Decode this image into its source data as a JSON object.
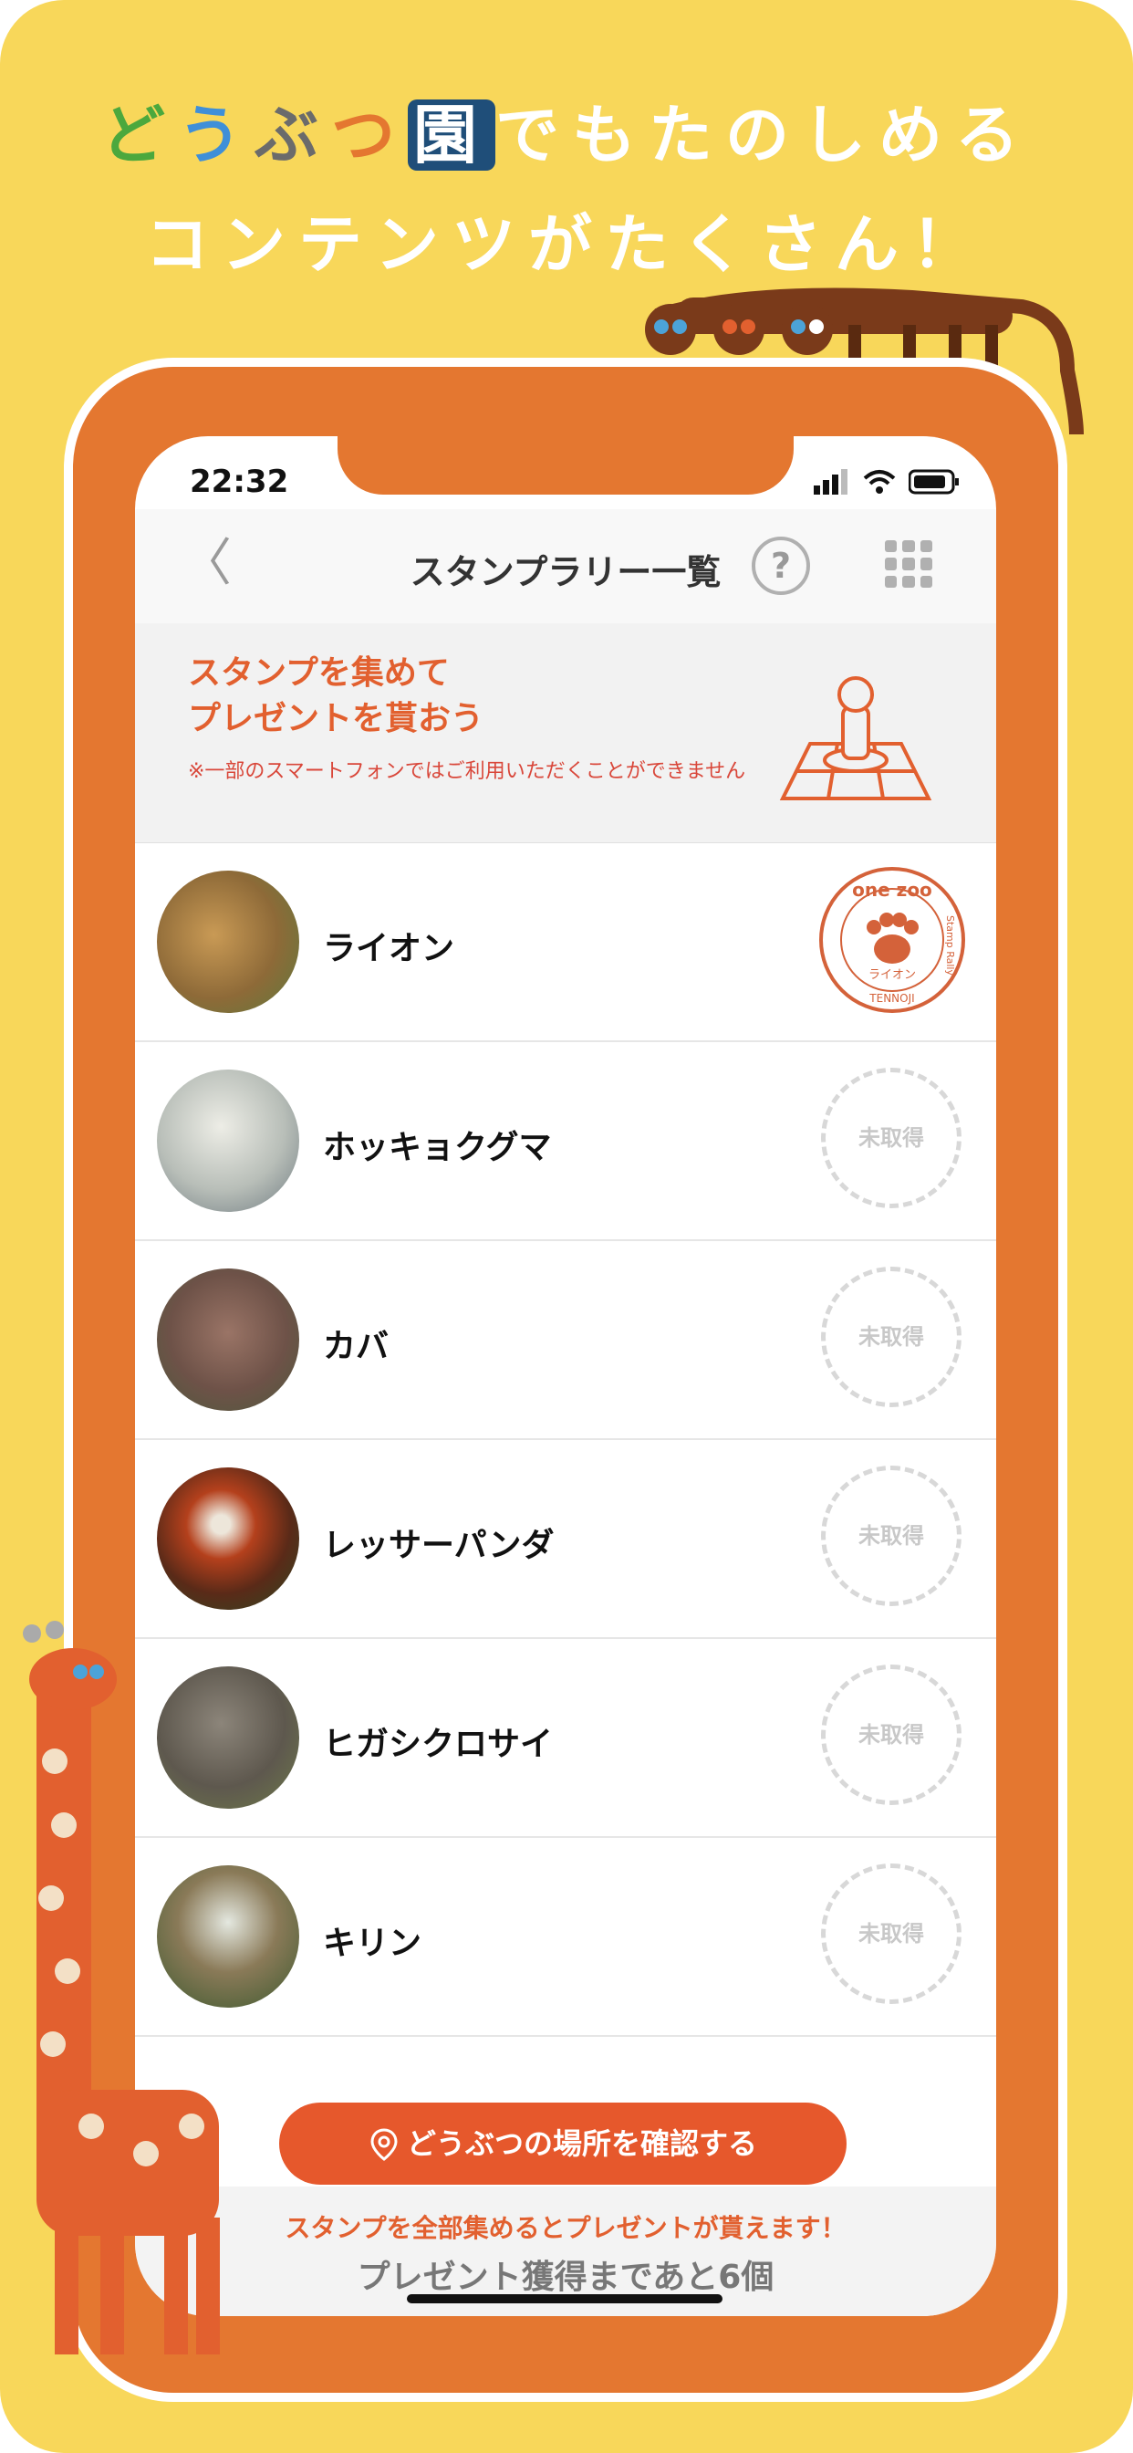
{
  "headline": {
    "line1_chars": [
      "ど",
      "う",
      "ぶ",
      "つ",
      "園",
      "でもたのしめる"
    ],
    "line1_colors": [
      "#4CA83D",
      "#3F8FD8",
      "#6B6B6B",
      "#E47730",
      "#ffffff",
      "#ffffff"
    ],
    "line2": "コンテンツがたくさん！"
  },
  "status_bar": {
    "time": "22:32"
  },
  "nav": {
    "back": "〈",
    "title": "スタンプラリー一覧",
    "help": "?"
  },
  "banner": {
    "title_line1": "スタンプを集めて",
    "title_line2": "プレゼントを貰おう",
    "note": "※一部のスマートフォンではご利用いただくことができません"
  },
  "stamp_got": {
    "top": "one zoo",
    "left": "Stamp Rally",
    "bottom": "TENNOJI",
    "label": "ライオン"
  },
  "animals": [
    {
      "name": "ライオン",
      "status": "",
      "acquired": true
    },
    {
      "name": "ホッキョクグマ",
      "status": "未取得",
      "acquired": false
    },
    {
      "name": "カバ",
      "status": "未取得",
      "acquired": false
    },
    {
      "name": "レッサーパンダ",
      "status": "未取得",
      "acquired": false
    },
    {
      "name": "ヒガシクロサイ",
      "status": "未取得",
      "acquired": false
    },
    {
      "name": "キリン",
      "status": "未取得",
      "acquired": false
    }
  ],
  "map_button": {
    "label": "どうぶつの場所を確認する"
  },
  "footer": {
    "message": "スタンプを全部集めるとプレゼントが貰えます！",
    "remaining": "プレゼント獲得まであと6個"
  },
  "colors": {
    "background": "#F8D75A",
    "frame": "#E47730",
    "accent": "#E2602F"
  }
}
